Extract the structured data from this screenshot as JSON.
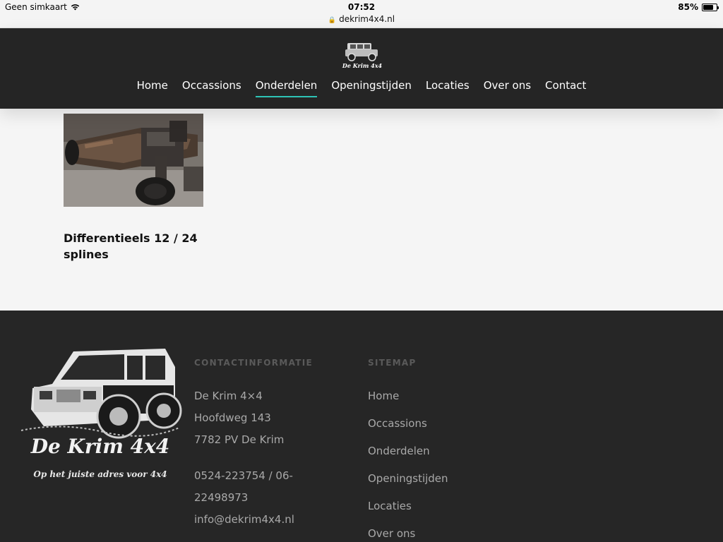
{
  "status_bar": {
    "carrier": "Geen simkaart",
    "time": "07:52",
    "url": "dekrim4x4.nl",
    "battery": "85%"
  },
  "header": {
    "logo_text": "De Krim 4x4",
    "nav": [
      {
        "label": "Home",
        "active": false
      },
      {
        "label": "Occassions",
        "active": false
      },
      {
        "label": "Onderdelen",
        "active": true
      },
      {
        "label": "Openingstijden",
        "active": false
      },
      {
        "label": "Locaties",
        "active": false
      },
      {
        "label": "Over ons",
        "active": false
      },
      {
        "label": "Contact",
        "active": false
      }
    ]
  },
  "product": {
    "title": "Differentieels 12 / 24 splines"
  },
  "footer": {
    "logo_text": "De Krim 4x4",
    "logo_tagline": "Op het juiste adres voor 4x4",
    "contact": {
      "heading": "CONTACTINFORMATIE",
      "name": "De Krim 4×4",
      "street": "Hoofdweg 143",
      "city": "7782 PV De Krim",
      "phone_line1": "0524-223754 / 06-",
      "phone_line2": "22498973",
      "email": "info@dekrim4x4.nl"
    },
    "sitemap": {
      "heading": "SITEMAP",
      "items": [
        "Home",
        "Occassions",
        "Onderdelen",
        "Openingstijden",
        "Locaties",
        "Over ons"
      ]
    }
  },
  "colors": {
    "header_bg": "#252525",
    "accent": "#2ec4b6",
    "footer_bg": "#262626",
    "page_bg": "#f5f5f5"
  }
}
